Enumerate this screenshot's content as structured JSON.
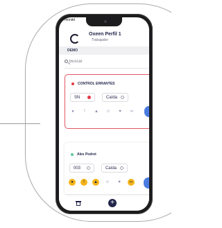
{
  "status_bar": {
    "time": "monitd"
  },
  "header": {
    "profile_name": "Oxeen Perfil 1",
    "profile_role": "Trabajador"
  },
  "org": {
    "label": "DEMO"
  },
  "search": {
    "placeholder": "Buscar"
  },
  "cards": [
    {
      "title": "CONTROL ERRANTES",
      "status": "alert",
      "code": "SN",
      "type": "Caída"
    },
    {
      "title": "Alex Podret",
      "status": "ok",
      "code": "003",
      "type": "Caída"
    }
  ],
  "card_icons": {
    "alert": [
      "person-fall-icon",
      "warning-icon",
      "fire-icon",
      "worker-icon",
      "heart-icon",
      "bluetooth-icon",
      "more-icon"
    ],
    "normal": [
      "person-fall-icon",
      "warning-icon",
      "fire-icon",
      "worker-icon",
      "heart-icon",
      "bluetooth-icon",
      "more-icon"
    ]
  },
  "bottom_nav": {
    "add_label": "+"
  },
  "colors": {
    "navy": "#1f2247",
    "alert_red": "#e53945",
    "ok_green": "#5cc69a",
    "accent_yellow": "#f4b41a",
    "accent_blue": "#4a7ce0"
  }
}
